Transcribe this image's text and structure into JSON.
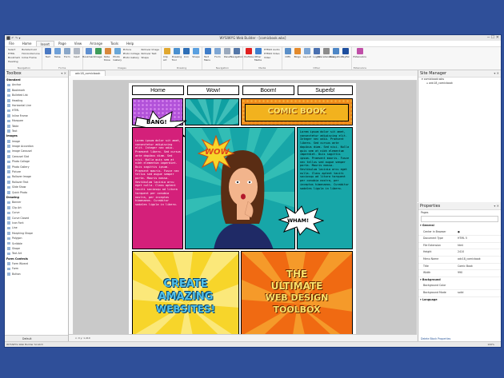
{
  "app": {
    "title": "WYSIWYG Web Builder - [comicbook.wbs]",
    "quick_access": "⬛ ↶ ↷ ▾"
  },
  "menu": [
    "File",
    "Home",
    "Insert",
    "Page",
    "View",
    "Arrange",
    "Tools",
    "Help"
  ],
  "menu_active_index": 2,
  "ribbon": {
    "groups": [
      {
        "label": "Navigation",
        "small": [
          "Select",
          "HTML",
          "Bookmark",
          "Heading"
        ],
        "buttons": [
          "Text",
          "Table"
        ]
      },
      {
        "label": "Forms",
        "small": [
          "Bulleted List",
          "Horizontal Line",
          "Inline Frame"
        ],
        "buttons": [
          "Form",
          "Input"
        ]
      },
      {
        "label": "Images",
        "buttons": [
          "Bookmark",
          "Image",
          "Slide Show",
          "Photo Gallery"
        ],
        "small": [
          "Picture",
          "Photo Collage",
          "Photo Gallery"
        ]
      },
      {
        "label": "Drawing",
        "small": [
          "Rollover Image",
          "Rollover Text",
          "Shape"
        ],
        "buttons": [
          "Clip Art",
          "Drawing Tool",
          "Icon",
          "Shape"
        ]
      },
      {
        "label": "Navigation",
        "buttons": [
          "Text Menu",
          "Form",
          "Panel",
          "Navigation"
        ]
      },
      {
        "label": "Media",
        "buttons": [
          "YouTube",
          "Other Media"
        ],
        "small": [
          "HTML5 Audio",
          "HTML5 Video",
          "Video"
        ]
      },
      {
        "label": "Other",
        "buttons": [
          "CMS",
          "Blogs",
          "Layout",
          "Logos",
          "Miscellaneous",
          "Navigation",
          "PayPal"
        ]
      },
      {
        "label": "Extensions",
        "buttons": [
          "Extensions"
        ]
      }
    ]
  },
  "toolbox": {
    "title": "Toolbox",
    "sections": [
      {
        "name": "Standard",
        "items": [
          "Anchor",
          "Bookmark",
          "Bulleted List",
          "Heading",
          "Horizontal Line",
          "HTML",
          "Inline Frame",
          "Marquee",
          "Table",
          "Text"
        ]
      },
      {
        "name": "Images",
        "items": [
          "Image",
          "Image Accordion",
          "Image Carousel",
          "Carousel Slot",
          "Photo Collage",
          "Photo Gallery",
          "Picture",
          "Rollover Image",
          "Rollover Text",
          "Slide Show",
          "Quick Photo"
        ]
      },
      {
        "name": "Drawing",
        "items": [
          "Banner",
          "Clip Art",
          "Curve",
          "Curve Closed",
          "Icon Font",
          "Line",
          "Morphing Shape",
          "Polygon",
          "Scribble",
          "Shape",
          "Text Art"
        ]
      },
      {
        "name": "Form Controls",
        "items": [
          "Form Wizard",
          "Form",
          "Button"
        ]
      }
    ],
    "bottom_tab": "Default"
  },
  "document_tab": "adc18_comicbook",
  "page": {
    "nav_items": [
      "Home",
      "Wow!",
      "Boom!",
      "Superb!"
    ],
    "comic_title": "COMIC BOOK",
    "bang": "BANG!",
    "wow": "WOW",
    "wham": "WHAM!",
    "left_text": "Lorem ipsum dolor sit amet, consectetur adipiscing elit. Integer nec odio. Praesent libero. Sed cursus ante dapibus diam. Sed nisi. Nulla quis sem at nibh elementum imperdiet. Duis sagittis ipsum. Praesent mauris. Fusce nec tellus sed augue semper porta. Mauris massa. Vestibulum lacinia arcu eget nulla. Class aptent taciti sociosqu ad litora torquent per conubia nostra, per inceptos himenaeos. Curabitur sodales ligula in libero.",
    "right_text": "Lorem ipsum dolor sit amet, consectetur adipiscing elit. Integer nec odio. Praesent libero. Sed cursus ante dapibus diam. Sed nisi. Nulla quis sem at nibh elementum imperdiet. Duis sagittis ipsum. Praesent mauris. Fusce nec tellus sed augue semper porta. Mauris massa. Vestibulum lacinia arcu eget nulla. Class aptent taciti sociosqu ad litora torquent per conubia nostra, per inceptos himenaeos. Curabitur sodales ligula in libero.",
    "create_line1": "CREATE",
    "create_line2": "AMAZING",
    "create_line3": "WEBSITES!",
    "ultimate_line1": "THE",
    "ultimate_line2": "ULTIMATE",
    "ultimate_line3": "WEB DESIGN",
    "ultimate_line4": "TOOLBOX"
  },
  "site_manager": {
    "title": "Site Manager",
    "tree": [
      "comicbook.wbs",
      "adc18_comicbook"
    ]
  },
  "properties": {
    "title": "Properties",
    "object": "Pages",
    "categories": [
      {
        "name": "General",
        "rows": [
          [
            "Center in Browser",
            "●"
          ],
          [
            "Document Type",
            "HTML 5"
          ],
          [
            "File Extension",
            "html"
          ],
          [
            "Height",
            "2410"
          ],
          [
            "Menu Name",
            "adc18_comicbook"
          ],
          [
            "Title",
            "Comic Book"
          ],
          [
            "Width",
            "990"
          ]
        ]
      },
      {
        "name": "Background",
        "rows": [
          [
            "Background Color",
            ""
          ],
          [
            "Background Mode",
            "solid"
          ]
        ]
      },
      {
        "name": "Language",
        "rows": []
      }
    ],
    "footer_link": "Delete Block Properties"
  },
  "status": {
    "left": "WYSIWYG Web Builder Scratch",
    "canvas": "x: 0 y: 1,410",
    "zoom": "100%"
  },
  "colors": {
    "window_bg": "#2f4f99",
    "accent": "#2b579a"
  }
}
